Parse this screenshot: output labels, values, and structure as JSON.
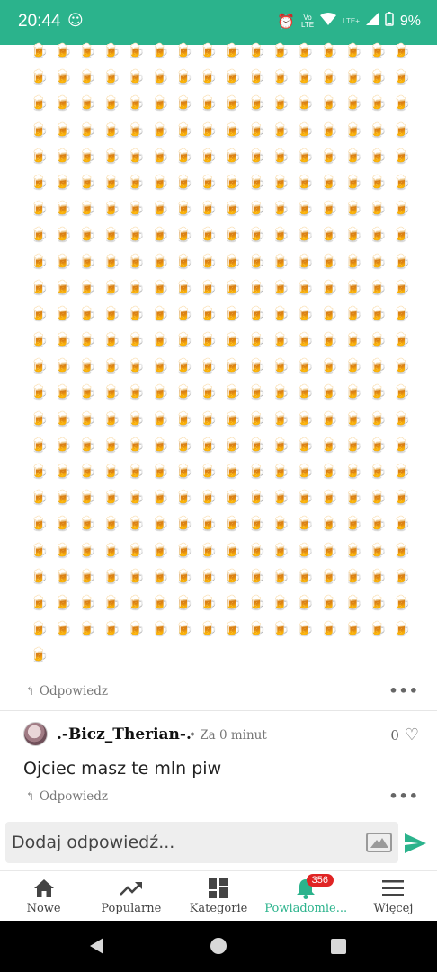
{
  "status_bar": {
    "time": "20:44",
    "indicator_vo": "Vo",
    "indicator_lte1": "LTE",
    "indicator_lte2": "LTE+",
    "battery": "9%"
  },
  "post_remainder": {
    "emoji": "🍺",
    "emoji_count": 369,
    "reply_label": "Odpowiedz"
  },
  "comment": {
    "author": ".-Bicz_Therian-.",
    "time": "Za 0 minut",
    "likes": "0",
    "body": "Ojciec masz te mln piw",
    "reply_label": "Odpowiedz"
  },
  "composer": {
    "placeholder": "Dodaj odpowiedź..."
  },
  "bottom_nav": {
    "items": [
      {
        "label": "Nowe",
        "icon": "home-icon"
      },
      {
        "label": "Popularne",
        "icon": "trending-icon"
      },
      {
        "label": "Kategorie",
        "icon": "grid-icon"
      },
      {
        "label": "Powiadomie...",
        "icon": "bell-icon",
        "badge": "356",
        "active": true
      },
      {
        "label": "Więcej",
        "icon": "menu-icon"
      }
    ]
  },
  "colors": {
    "accent": "#2bb38c",
    "badge": "#e02424"
  }
}
